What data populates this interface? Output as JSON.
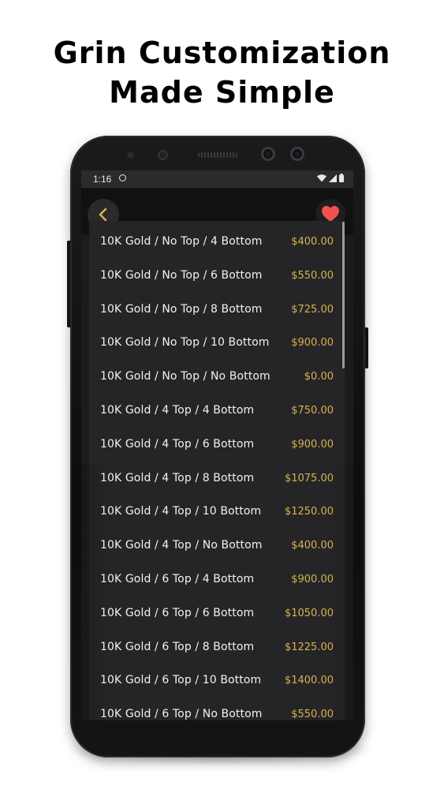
{
  "headline": {
    "line1": "Grin Customization",
    "line2": "Made Simple"
  },
  "status_bar": {
    "time": "1:16",
    "icons": [
      "app-notification-icon",
      "wifi-icon",
      "signal-icon",
      "battery-icon"
    ]
  },
  "app_bar": {
    "back_icon": "chevron-left-icon",
    "favorite_icon": "heart-icon"
  },
  "colors": {
    "accent_gold": "#d8b34a",
    "heart_red": "#f0524b",
    "list_bg": "#252528",
    "screen_bg": "#1c1c1f"
  },
  "options": [
    {
      "label": "10K Gold / No Top / 4 Bottom",
      "price": "$400.00"
    },
    {
      "label": "10K Gold / No Top / 6 Bottom",
      "price": "$550.00"
    },
    {
      "label": "10K Gold / No Top / 8 Bottom",
      "price": "$725.00"
    },
    {
      "label": "10K Gold / No Top / 10 Bottom",
      "price": "$900.00"
    },
    {
      "label": "10K Gold / No Top / No Bottom",
      "price": "$0.00"
    },
    {
      "label": "10K Gold / 4 Top / 4 Bottom",
      "price": "$750.00"
    },
    {
      "label": "10K Gold / 4 Top / 6 Bottom",
      "price": "$900.00"
    },
    {
      "label": "10K Gold / 4 Top / 8 Bottom",
      "price": "$1075.00"
    },
    {
      "label": "10K Gold / 4 Top / 10 Bottom",
      "price": "$1250.00"
    },
    {
      "label": "10K Gold / 4 Top / No Bottom",
      "price": "$400.00"
    },
    {
      "label": "10K Gold / 6 Top / 4 Bottom",
      "price": "$900.00"
    },
    {
      "label": "10K Gold / 6 Top / 6 Bottom",
      "price": "$1050.00"
    },
    {
      "label": "10K Gold / 6 Top / 8 Bottom",
      "price": "$1225.00"
    },
    {
      "label": "10K Gold / 6 Top / 10 Bottom",
      "price": "$1400.00"
    },
    {
      "label": "10K Gold / 6 Top / No Bottom",
      "price": "$550.00"
    }
  ]
}
